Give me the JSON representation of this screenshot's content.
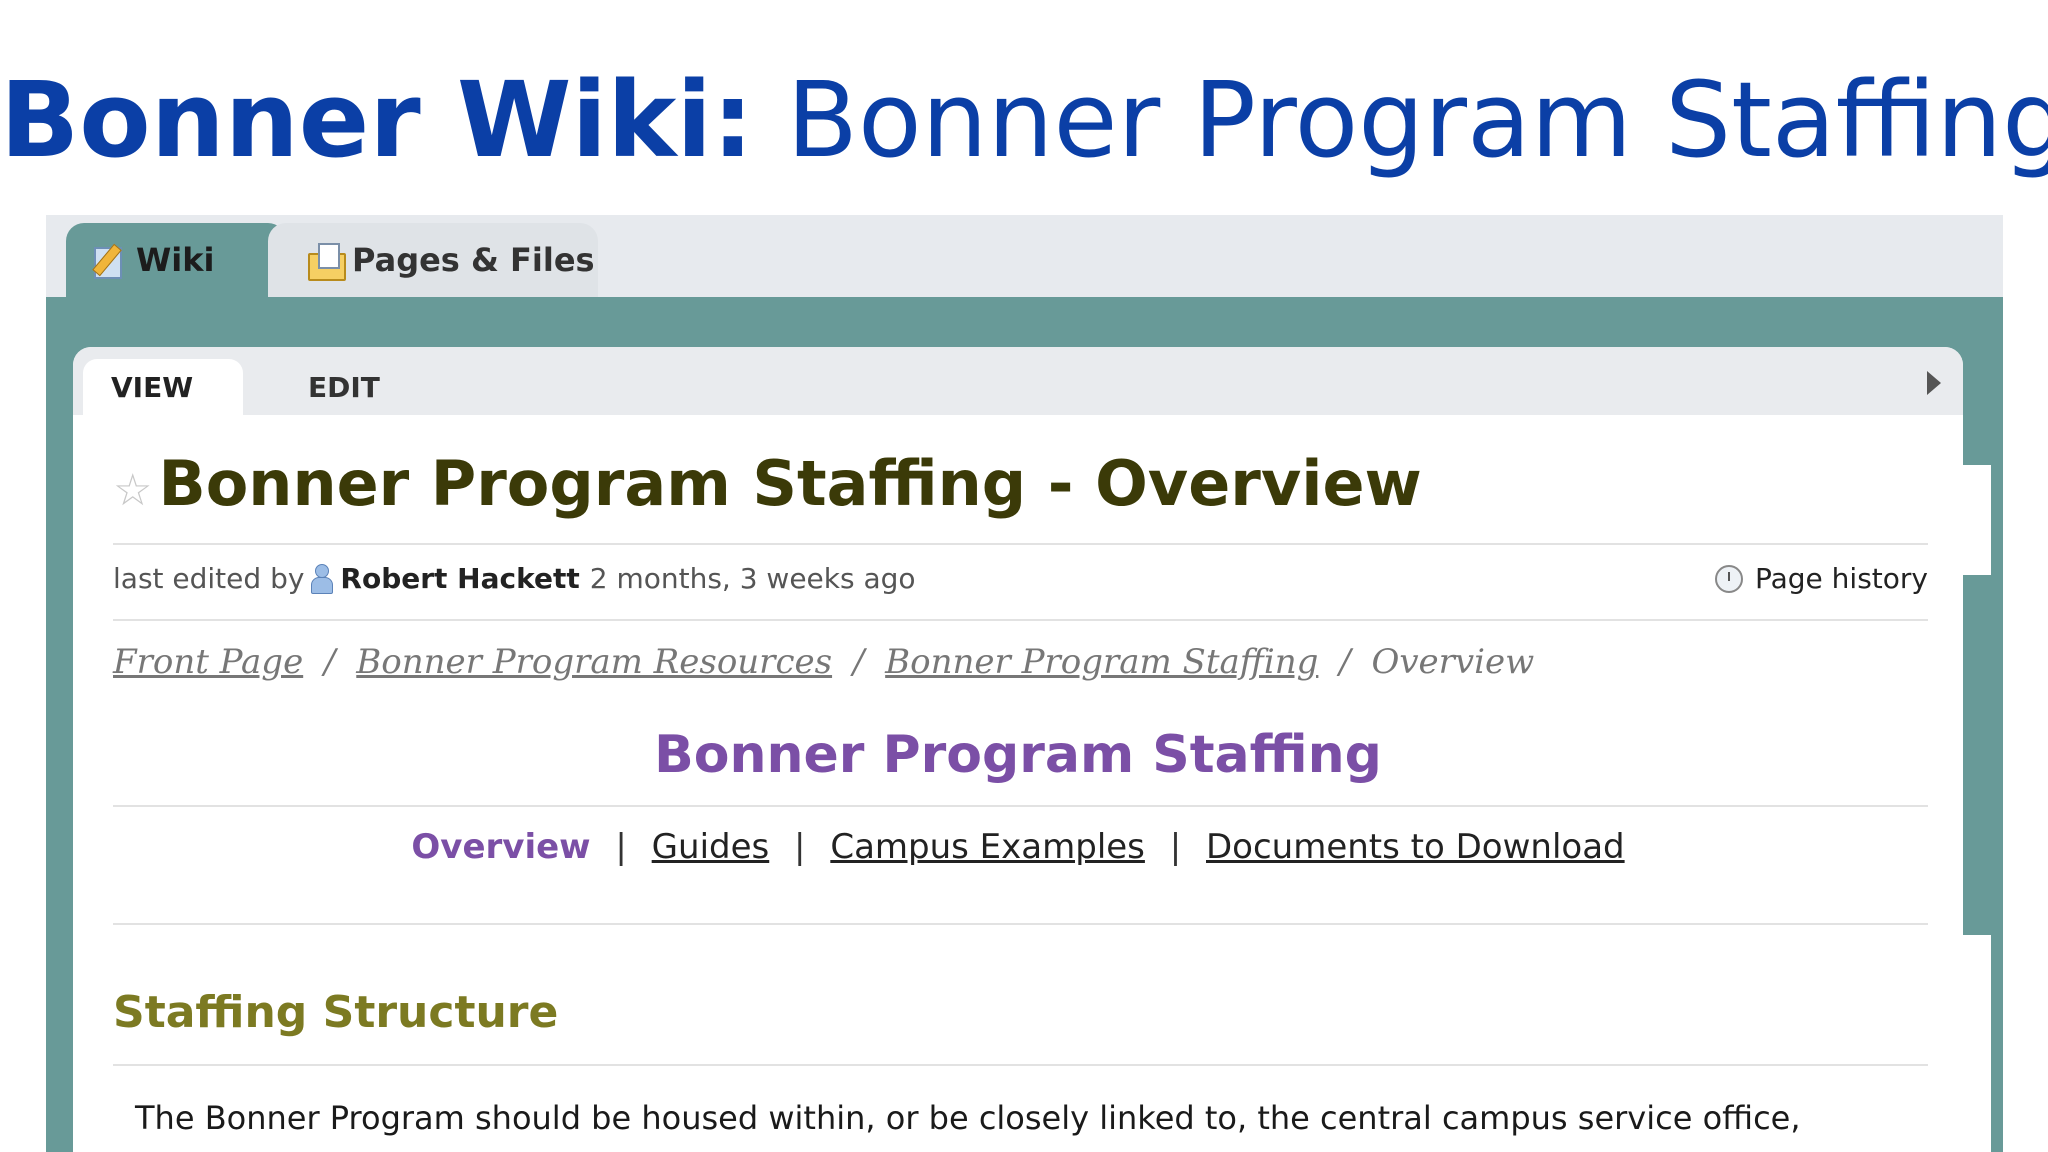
{
  "slide": {
    "title_bold": "Bonner Wiki:",
    "title_light": "Bonner Program Staffing"
  },
  "main_tabs": [
    {
      "label": "Wiki",
      "icon": "pencil-icon",
      "active": true
    },
    {
      "label": "Pages & Files",
      "icon": "folder-icon",
      "active": false
    }
  ],
  "sub_tabs": {
    "view": "VIEW",
    "edit": "EDIT"
  },
  "page": {
    "title": "Bonner Program Staffing - Overview",
    "last_edited_prefix": "last edited by",
    "author": "Robert Hackett",
    "edited_ago": "2 months, 3 weeks ago",
    "history_label": "Page history"
  },
  "breadcrumb": {
    "items": [
      "Front Page",
      "Bonner Program Resources",
      "Bonner Program Staffing"
    ],
    "current": "Overview",
    "separator": "/"
  },
  "content": {
    "section_title": "Bonner Program Staffing",
    "subnav": {
      "current": "Overview",
      "links": [
        "Guides",
        "Campus Examples",
        "Documents to Download"
      ],
      "separator": "|"
    },
    "heading": "Staffing Structure",
    "paragraph_start": "The Bonner Program should be housed within, or be closely linked to, the central campus service office,"
  },
  "colors": {
    "slide_title": "#0b3fa6",
    "frame": "#689a98",
    "page_title": "#3b3a08",
    "section_title": "#7b4fa6",
    "heading": "#7c7a22"
  }
}
